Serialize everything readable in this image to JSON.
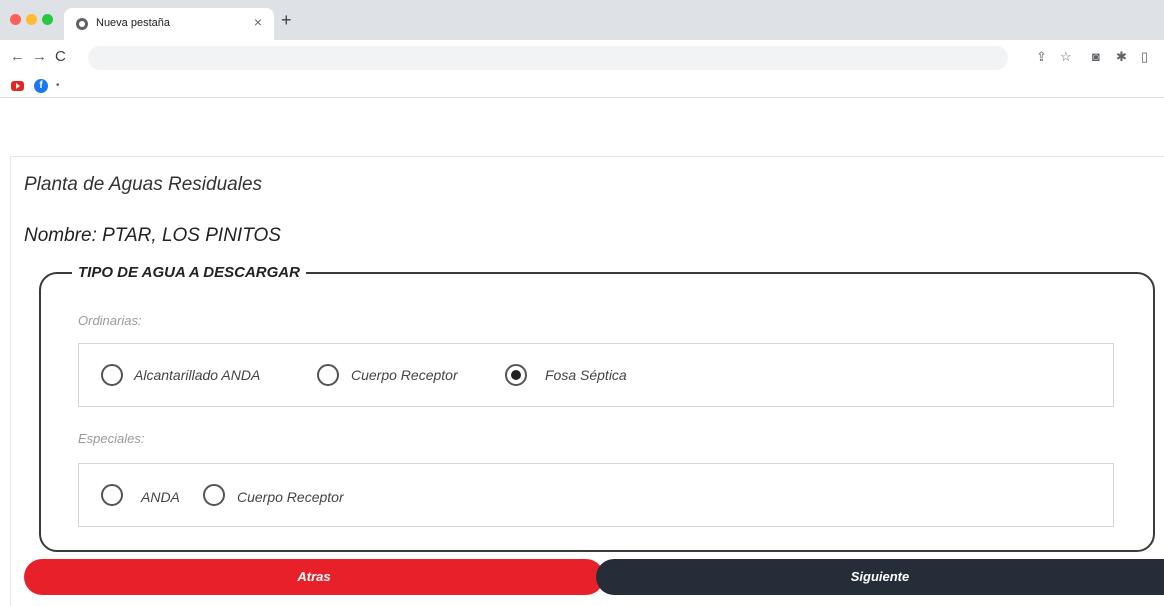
{
  "browser": {
    "tab_title": "Nueva pestaña",
    "tab_close": "×",
    "new_tab": "+",
    "nav_back": "←",
    "nav_forward": "→",
    "nav_reload": "C",
    "fb_letter": "f",
    "bookmark_more": "•",
    "toolbar_icons": [
      "share-icon",
      "star-icon",
      "extension-icon",
      "puzzle-icon",
      "sidepanel-icon"
    ]
  },
  "page": {
    "title": "Planta de Aguas Residuales",
    "name_line": "Nombre: PTAR, LOS PINITOS",
    "legend": "TIPO DE AGUA A DESCARGAR",
    "ordinary_label": "Ordinarias:",
    "ordinary_options": [
      {
        "label": "Alcantarillado ANDA",
        "checked": false
      },
      {
        "label": "Cuerpo Receptor",
        "checked": false
      },
      {
        "label": "Fosa Séptica",
        "checked": true
      }
    ],
    "special_label": "Especiales:",
    "special_options": [
      {
        "label": "ANDA",
        "checked": false
      },
      {
        "label": "Cuerpo Receptor",
        "checked": false
      }
    ],
    "back_button": "Atras",
    "next_button": "Siguiente"
  },
  "colors": {
    "back_button": "#e8202a",
    "next_button": "#252d38"
  }
}
